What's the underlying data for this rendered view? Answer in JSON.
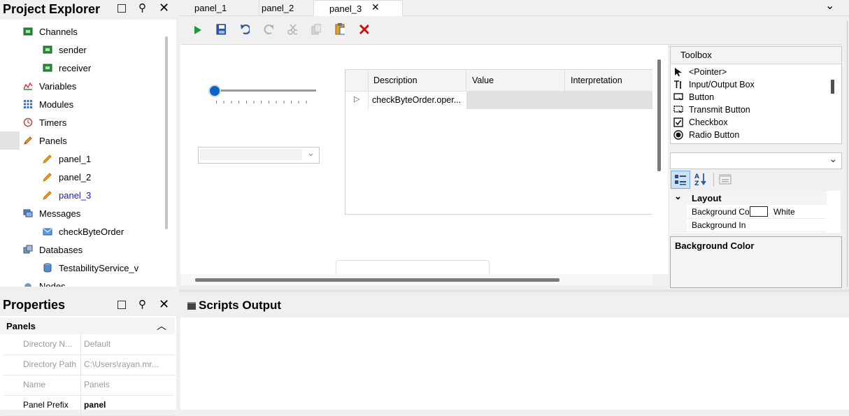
{
  "project_explorer": {
    "title": "Project Explorer",
    "items": [
      {
        "label": "Channels",
        "icon": "channels-icon",
        "level": 1
      },
      {
        "label": "sender",
        "icon": "channel-icon",
        "level": 2
      },
      {
        "label": "receiver",
        "icon": "channel-icon",
        "level": 2
      },
      {
        "label": "Variables",
        "icon": "variables-icon",
        "level": 1
      },
      {
        "label": "Modules",
        "icon": "modules-icon",
        "level": 1
      },
      {
        "label": "Timers",
        "icon": "timer-icon",
        "level": 1
      },
      {
        "label": "Panels",
        "icon": "panels-icon",
        "level": 1
      },
      {
        "label": "panel_1",
        "icon": "pencil-icon",
        "level": 2
      },
      {
        "label": "panel_2",
        "icon": "pencil-icon",
        "level": 2
      },
      {
        "label": "panel_3",
        "icon": "pencil-icon",
        "level": 2
      },
      {
        "label": "Messages",
        "icon": "messages-icon",
        "level": 1
      },
      {
        "label": "checkByteOrder",
        "icon": "envelope-icon",
        "level": 2
      },
      {
        "label": "Databases",
        "icon": "databases-icon",
        "level": 1
      },
      {
        "label": "TestabilityService_v",
        "icon": "database-icon",
        "level": 2
      },
      {
        "label": "Nodes",
        "icon": "nodes-icon",
        "level": 1
      }
    ]
  },
  "properties": {
    "title": "Properties",
    "section": "Panels",
    "rows": [
      {
        "key": "Directory N...",
        "value": "Default"
      },
      {
        "key": "Directory Path",
        "value": "C:\\Users\\rayan.mr..."
      },
      {
        "key": "Name",
        "value": "Panels"
      },
      {
        "key": "Panel Prefix",
        "value": "panel"
      }
    ]
  },
  "editor": {
    "tabs": [
      {
        "label": "panel_1"
      },
      {
        "label": "panel_2"
      },
      {
        "label": "panel_3"
      }
    ],
    "table": {
      "columns": [
        "Description",
        "Value",
        "Interpretation"
      ],
      "rows": [
        {
          "description": "checkByteOrder.oper...",
          "value": "",
          "interpretation": ""
        }
      ]
    },
    "slider_value": 0
  },
  "toolbox": {
    "title": "Toolbox",
    "items": [
      {
        "label": "<Pointer>",
        "icon": "pointer-icon"
      },
      {
        "label": "Input/Output Box",
        "icon": "text-box-icon"
      },
      {
        "label": "Button",
        "icon": "button-icon"
      },
      {
        "label": "Transmit Button",
        "icon": "transmit-button-icon"
      },
      {
        "label": "Checkbox",
        "icon": "checkbox-icon"
      },
      {
        "label": "Radio Button",
        "icon": "radio-button-icon"
      }
    ]
  },
  "property_grid": {
    "section": "Layout",
    "rows": [
      {
        "key": "Background Co",
        "value": "White"
      },
      {
        "key": "Background In",
        "value": ""
      }
    ],
    "description_title": "Background Color"
  },
  "scripts_output": {
    "title": "Scripts Output"
  },
  "colors": {
    "accent": "#0a64c8",
    "active_tab_text": "#1a1aa6",
    "delete_red": "#d01010",
    "run_green": "#1e9a3c"
  }
}
